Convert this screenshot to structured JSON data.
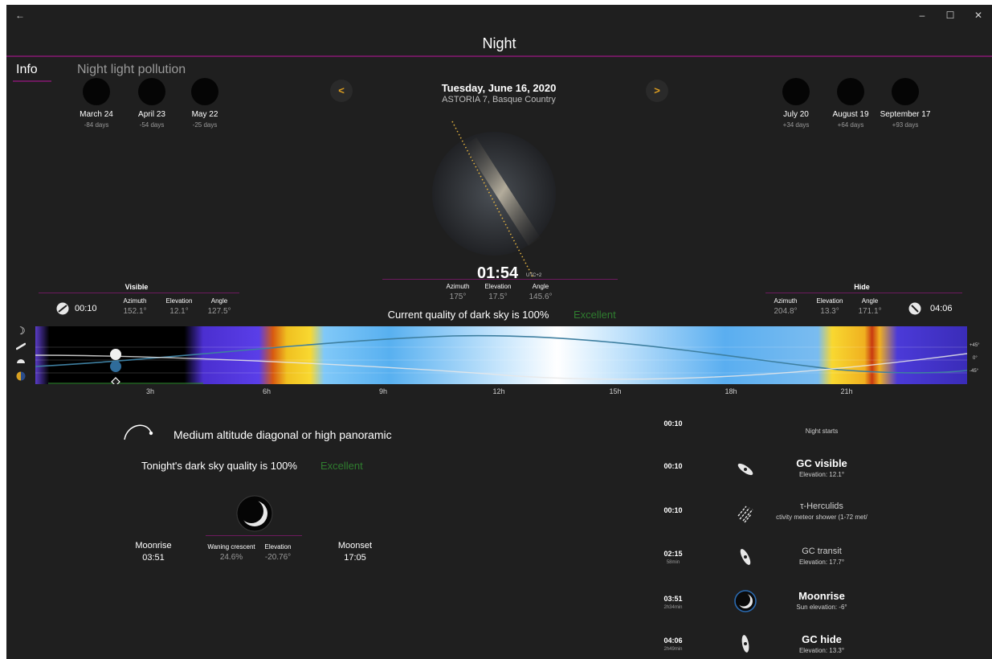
{
  "window": {
    "title": "Night",
    "back_glyph": "←",
    "min_glyph": "–",
    "max_glyph": "☐",
    "close_glyph": "✕"
  },
  "tabs": [
    {
      "label": "Info"
    },
    {
      "label": "Night light pollution"
    }
  ],
  "prev_moons": [
    {
      "date": "March 24",
      "delta": "-84 days"
    },
    {
      "date": "April 23",
      "delta": "-54 days"
    },
    {
      "date": "May 22",
      "delta": "-25 days"
    }
  ],
  "next_moons": [
    {
      "date": "July 20",
      "delta": "+34 days"
    },
    {
      "date": "August 19",
      "delta": "+64 days"
    },
    {
      "date": "September 17",
      "delta": "+93 days"
    }
  ],
  "header": {
    "date": "Tuesday, June 16, 2020",
    "location": "ASTORIA 7, Basque Country",
    "prev_glyph": "<",
    "next_glyph": ">"
  },
  "current": {
    "time": "01:54",
    "utc": "UTC+2",
    "azimuth_label": "Azimuth",
    "azimuth": "175°",
    "elevation_label": "Elevation",
    "elevation": "17.5°",
    "angle_label": "Angle",
    "angle": "145.6°",
    "quality_text": "Current quality of dark sky is 100%",
    "quality_rating": "Excellent"
  },
  "visible": {
    "header": "Visible",
    "time": "00:10",
    "azimuth_label": "Azimuth",
    "azimuth": "152.1°",
    "elevation_label": "Elevation",
    "elevation": "12.1°",
    "angle_label": "Angle",
    "angle": "127.5°"
  },
  "hide": {
    "header": "Hide",
    "time": "04:06",
    "azimuth_label": "Azimuth",
    "azimuth": "204.8°",
    "elevation_label": "Elevation",
    "elevation": "13.3°",
    "angle_label": "Angle",
    "angle": "171.1°"
  },
  "timeline": {
    "hours": [
      "3h",
      "6h",
      "9h",
      "12h",
      "15h",
      "18h",
      "21h"
    ],
    "degrees": [
      "+45°",
      "0°",
      "-45°"
    ]
  },
  "summary": {
    "composition": "Medium altitude diagonal or high panoramic",
    "tonight_text": "Tonight's dark sky quality is 100%",
    "tonight_rating": "Excellent"
  },
  "moon": {
    "moonrise_label": "Moonrise",
    "moonrise": "03:51",
    "phase_label": "Waning crescent",
    "phase_value": "24.6%",
    "elevation_label": "Elevation",
    "elevation_value": "-20.76°",
    "moonset_label": "Moonset",
    "moonset": "17:05"
  },
  "events": [
    {
      "time": "00:10",
      "duration": "",
      "title": "",
      "subtitle": "Night starts",
      "icon": "night-icon"
    },
    {
      "time": "00:10",
      "duration": "",
      "title": "GC visible",
      "subtitle": "Elevation: 12.1°",
      "icon": "galaxy-icon"
    },
    {
      "time": "00:10",
      "duration": "",
      "title": "τ-Herculids",
      "subtitle": "ctivity meteor shower (1-72 met/",
      "icon": "meteor-icon"
    },
    {
      "time": "02:15",
      "duration": "58min",
      "title": "GC transit",
      "subtitle": "Elevation: 17.7°",
      "icon": "galaxy-transit-icon"
    },
    {
      "time": "03:51",
      "duration": "2h34min",
      "title": "Moonrise",
      "subtitle": "Sun elevation: -6°",
      "icon": "moon-icon"
    },
    {
      "time": "04:06",
      "duration": "2h49min",
      "title": "GC hide",
      "subtitle": "Elevation: 13.3°",
      "icon": "galaxy-hide-icon"
    }
  ],
  "colors": {
    "accent": "#6d1a5e",
    "excellent": "#2f7d2f",
    "nav_arrow": "#e0a020"
  }
}
